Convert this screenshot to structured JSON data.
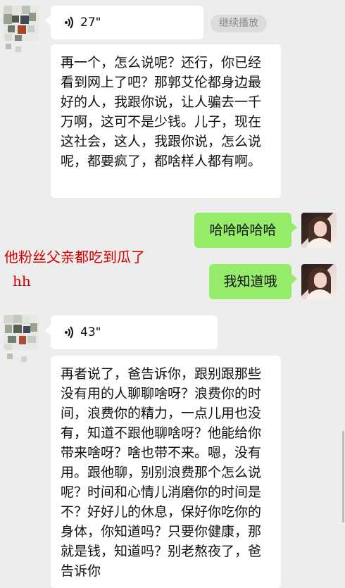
{
  "messages": [
    {
      "side": "left",
      "type": "voice",
      "duration": "27\"",
      "continue_label": "继续播放"
    },
    {
      "side": "left",
      "type": "text",
      "text": "再一个，怎么说呢？还行，你已经看到网上了吧？那郭艾伦都身边最好的人，我跟你说，让人骗去一千万啊，这可不是少钱。儿子，现在这社会，这人，我跟你说，怎么说呢，都要疯了，都啥样人都有啊。"
    },
    {
      "side": "right",
      "type": "text",
      "text": "哈哈哈哈哈"
    },
    {
      "side": "right",
      "type": "text",
      "text": "我知道哦"
    },
    {
      "side": "left",
      "type": "voice",
      "duration": "43\""
    },
    {
      "side": "left",
      "type": "text",
      "text": "再者说了，爸告诉你，跟别跟那些没有用的人聊聊啥呀？浪费你的时间，浪费你的精力，一点儿用也没有，知道不跟他聊啥呀？他能给你带来啥呀？啥也带不来。嗯，没有用。跟他聊，别别浪费那个怎么说呢？时间和心情儿消磨你的时间是不？好好儿的休息，保好你吃你的身体，你知道吗？只要你健康，那就是钱，知道吗？别老熬夜了，爸告诉你"
    }
  ],
  "annotation": {
    "line1": "他粉丝父亲都吃到瓜了",
    "line2": "hh",
    "color": "#d40000"
  },
  "icons": {
    "voice": "voice-wave-icon"
  },
  "colors": {
    "background": "#ededed",
    "incoming_bubble": "#ffffff",
    "outgoing_bubble": "#95ec69"
  }
}
